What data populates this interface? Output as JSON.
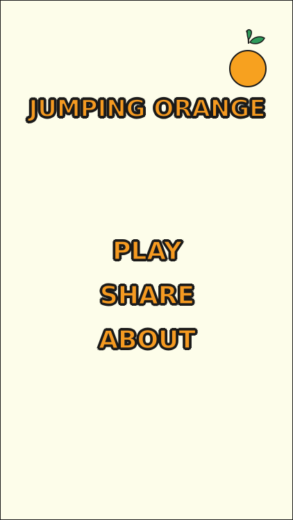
{
  "game": {
    "title": "JUMPING ORANGE"
  },
  "menu": {
    "items": [
      {
        "label": "PLAY"
      },
      {
        "label": "SHARE"
      },
      {
        "label": "ABOUT"
      }
    ]
  },
  "colors": {
    "background": "#fdfdea",
    "orange": "#f59a21",
    "outline": "#1a1a1a",
    "leaf": "#2e9a5a"
  },
  "icons": {
    "logo": "orange-icon"
  }
}
